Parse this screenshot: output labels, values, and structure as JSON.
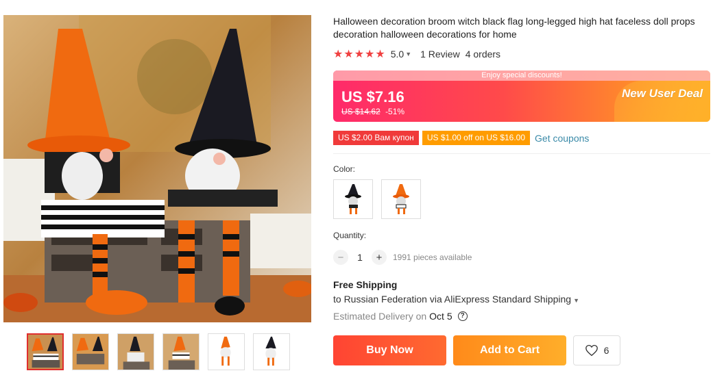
{
  "product": {
    "title": "Halloween decoration broom witch black flag long-legged high hat faceless doll props decoration halloween decorations for home",
    "rating": {
      "stars": "★★★★★",
      "value": "5.0",
      "reviews": "1 Review",
      "orders": "4 orders"
    }
  },
  "price": {
    "banner": "Enjoy special discounts!",
    "current": "US $7.16",
    "original": "US $14.62",
    "discount": "-51%",
    "deal_label": "New User Deal"
  },
  "coupons": {
    "items": [
      {
        "label": "US $2.00 Вам купон",
        "color": "#f03a3a"
      },
      {
        "label": "US $1.00 off on US $16.00",
        "color": "#ff9c00"
      }
    ],
    "get_coupons": "Get coupons"
  },
  "color": {
    "label": "Color:",
    "options": [
      "black-hat-gnome",
      "orange-hat-gnome"
    ]
  },
  "quantity": {
    "label": "Quantity:",
    "value": "1",
    "available": "1991 pieces available"
  },
  "shipping": {
    "title": "Free Shipping",
    "route": "to Russian Federation via AliExpress Standard Shipping",
    "delivery_prefix": "Estimated Delivery on",
    "delivery_date": "Oct 5"
  },
  "actions": {
    "buy_now": "Buy Now",
    "add_to_cart": "Add to Cart",
    "wishlist_count": "6"
  },
  "gallery": {
    "thumbnail_count": 6,
    "active_index": 0
  },
  "colors": {
    "accent_red": "#f04040",
    "buy_button": "#ff4433",
    "cart_button": "#ff9a20",
    "link": "#3a8aa8"
  }
}
